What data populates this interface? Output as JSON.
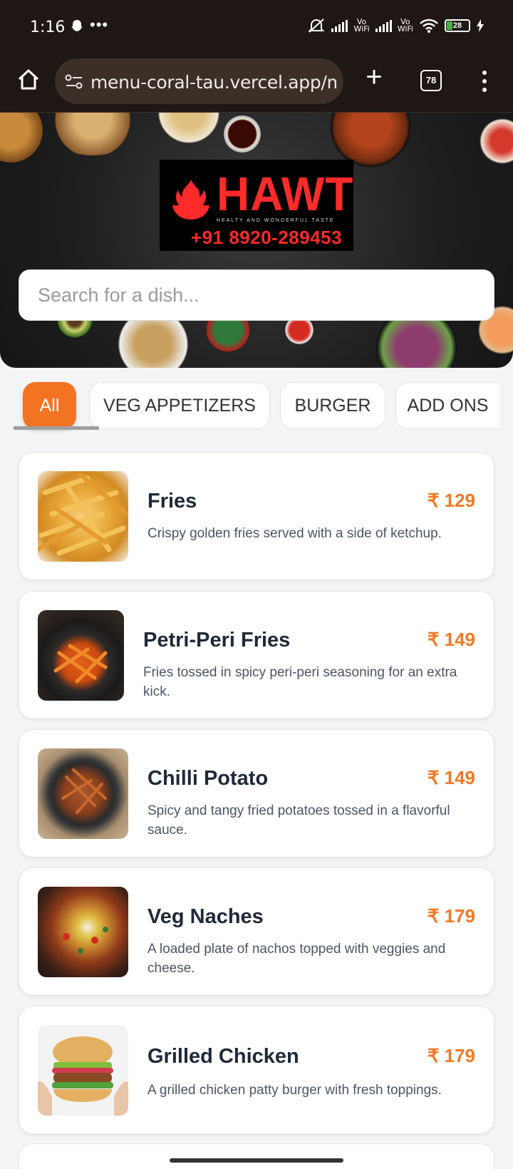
{
  "status_bar": {
    "time": "1:16",
    "battery": "28",
    "wifi_label_1": "Vo\nWiFi",
    "wifi_label_2": "Vo\nWiFi"
  },
  "browser": {
    "url": "menu-coral-tau.vercel.app/m",
    "tab_count": "78"
  },
  "hero": {
    "brand": "HAWT",
    "tagline": "HEALTY AND WONDERFUL TASTE",
    "phone": "+91 8920-289453",
    "search_placeholder": "Search for a dish..."
  },
  "categories": [
    {
      "label": "All",
      "active": true
    },
    {
      "label": "VEG APPETIZERS",
      "active": false
    },
    {
      "label": "BURGER",
      "active": false
    },
    {
      "label": "ADD ONS",
      "active": false
    }
  ],
  "currency": "₹",
  "menu": [
    {
      "name": "Fries",
      "price": "₹ 129",
      "description": "Crispy golden fries served with a side of ketchup.",
      "image": "fries-photo"
    },
    {
      "name": "Petri-Peri Fries",
      "price": "₹ 149",
      "description": "Fries tossed in spicy peri-peri seasoning for an extra kick.",
      "image": "peri-peri-fries-photo"
    },
    {
      "name": "Chilli Potato",
      "price": "₹ 149",
      "description": "Spicy and tangy fried potatoes tossed in a flavorful sauce.",
      "image": "chilli-potato-photo"
    },
    {
      "name": "Veg Naches",
      "price": "₹ 179",
      "description": "A loaded plate of nachos topped with veggies and cheese.",
      "image": "veg-nachos-photo"
    },
    {
      "name": "Grilled Chicken",
      "price": "₹ 179",
      "description": "A grilled chicken patty burger with fresh toppings.",
      "image": "grilled-chicken-burger-photo"
    }
  ],
  "colors": {
    "accent": "#f27321",
    "price": "#ee7a26",
    "browser_bg": "#1e1713"
  }
}
